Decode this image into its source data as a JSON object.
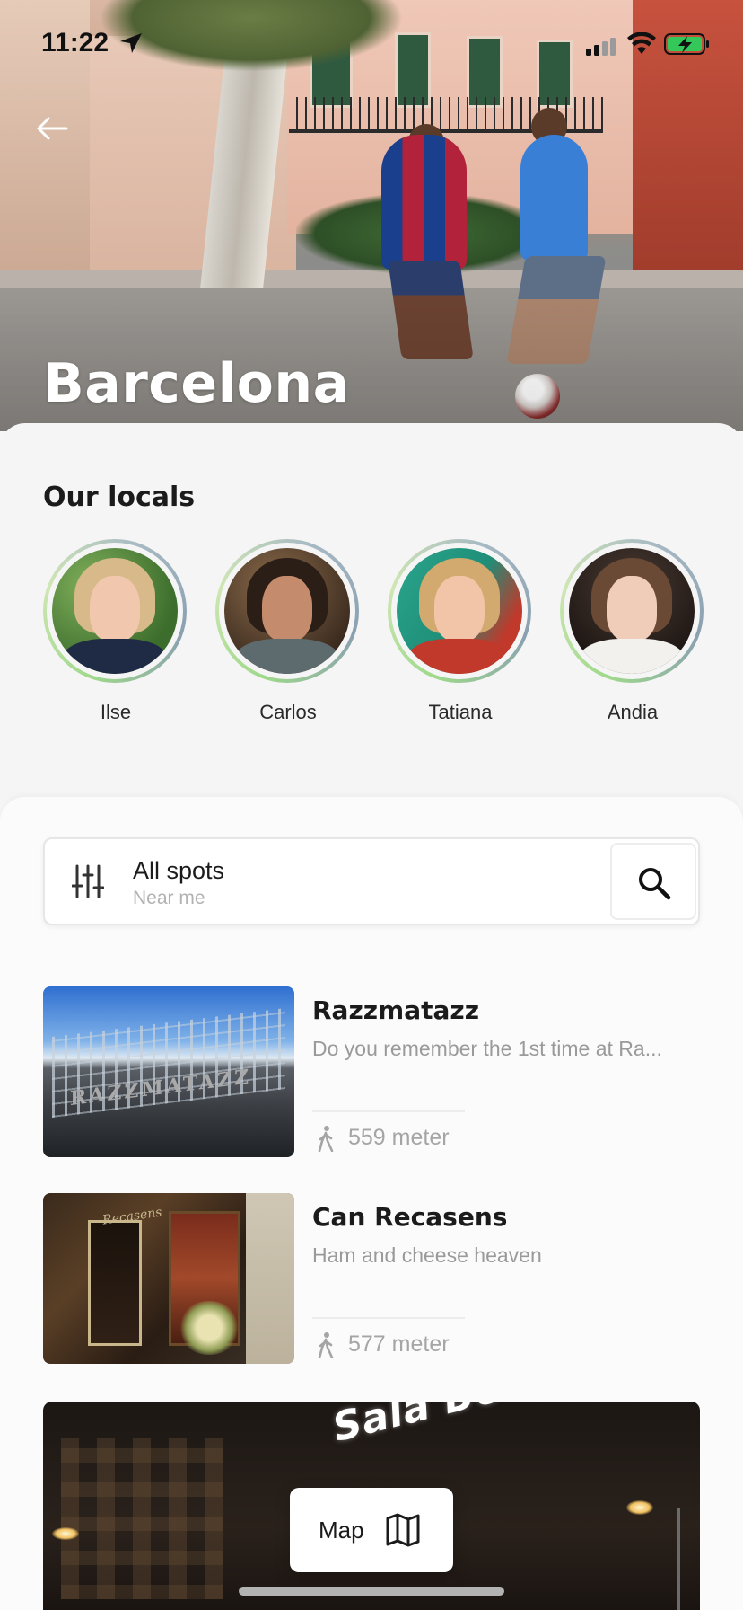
{
  "status_bar": {
    "time": "11:22"
  },
  "hero": {
    "city": "Barcelona"
  },
  "locals": {
    "title": "Our locals",
    "people": [
      {
        "name": "Ilse"
      },
      {
        "name": "Carlos"
      },
      {
        "name": "Tatiana"
      },
      {
        "name": "Andia"
      }
    ]
  },
  "filter": {
    "title": "All spots",
    "subtitle": "Near me"
  },
  "spots": [
    {
      "title": "Razzmatazz",
      "description": "Do you remember the 1st time at Ra...",
      "distance": "559 meter",
      "image_text": "RAZZMATAZZ"
    },
    {
      "title": "Can Recasens",
      "description": "Ham and cheese heaven",
      "distance": "577 meter",
      "image_text": "Recasens"
    }
  ],
  "featured": {
    "sign_text": "Sala Beckett"
  },
  "map_button": {
    "label": "Map"
  }
}
